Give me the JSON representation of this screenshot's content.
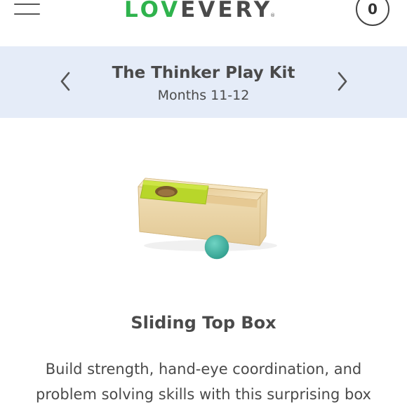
{
  "header": {
    "logo": {
      "part1": "LOV",
      "part2": "EVERY",
      "mark": "®"
    },
    "cart_count": "0",
    "icons": {
      "menu": "hamburger-menu-icon",
      "cart": "cart-count-badge"
    }
  },
  "kit": {
    "title": "The Thinker Play Kit",
    "subtitle": "Months 11-12",
    "icons": {
      "prev": "chevron-left-icon",
      "next": "chevron-right-icon"
    }
  },
  "product": {
    "name": "Sliding Top Box",
    "description": "Build strength, hand-eye coordination, and problem solving skills with this surprising box"
  },
  "colors": {
    "brand_green": "#2fb34d",
    "text_dark": "#4a4a4a",
    "banner_bg": "#e5ecf8"
  }
}
